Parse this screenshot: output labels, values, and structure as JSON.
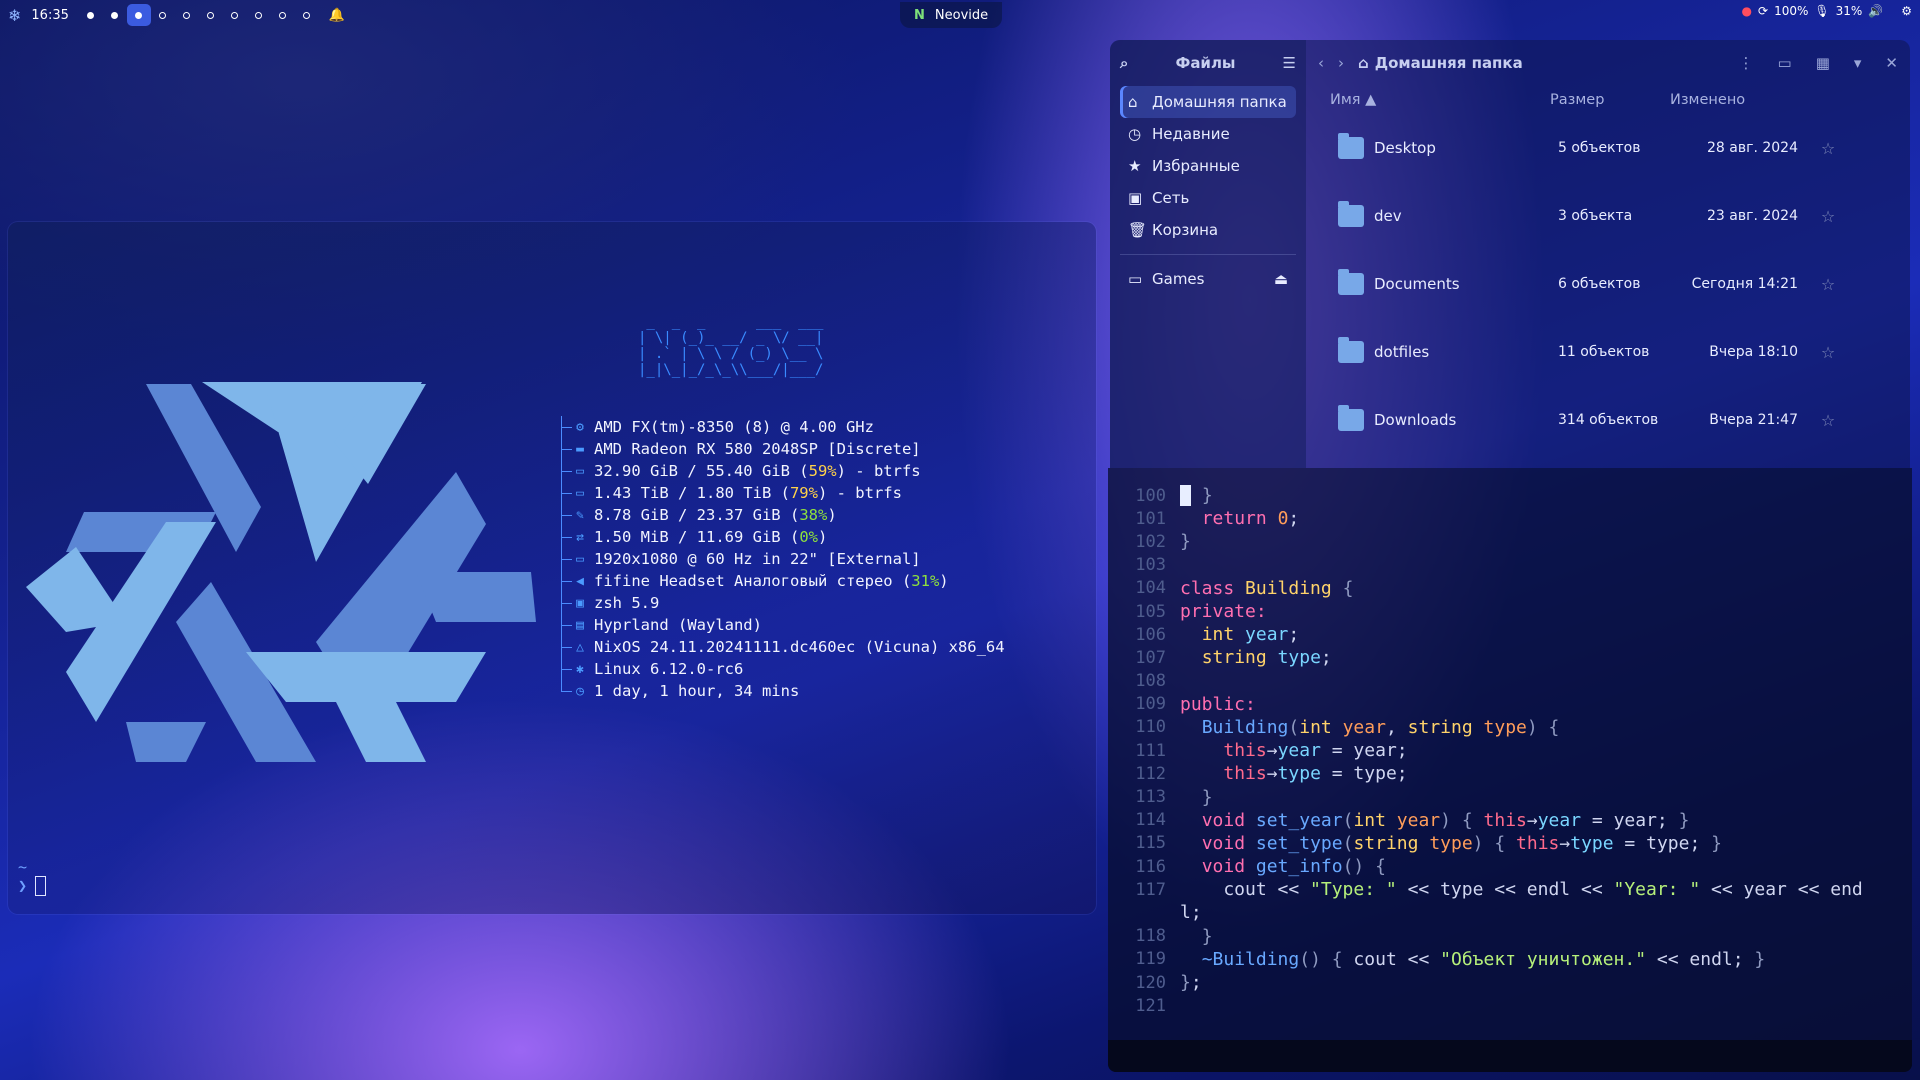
{
  "topbar": {
    "time": "16:35",
    "workspaces": [
      "full",
      "full",
      "active",
      "empty",
      "empty",
      "empty",
      "empty",
      "empty",
      "empty",
      "empty"
    ],
    "active_app": "Neovide",
    "battery": "100%",
    "volume": "31%",
    "icons": [
      "nixos-logo-icon",
      "bell-icon",
      "record-icon",
      "refresh-icon",
      "mic-icon",
      "speaker-icon",
      "gear-icon"
    ]
  },
  "terminal": {
    "ascii": " _  _  _      ___  ___\n| \\| (_)_ __/ _ \\/ __|\n| .` | \\ \\ / (_) \\__ \\\n|_|\\_|_/_\\_\\\\___/|___/",
    "info": [
      {
        "icon": "cpu-icon",
        "text": "AMD FX(tm)-8350 (8) @ 4.00 GHz",
        "pct": "",
        "suffix": ""
      },
      {
        "icon": "gpu-icon",
        "text": "AMD Radeon RX 580 2048SP [Discrete]",
        "pct": "",
        "suffix": ""
      },
      {
        "icon": "disk-icon",
        "text": "32.90 GiB / 55.40 GiB (",
        "pct": "59%",
        "pct_color": "y",
        "suffix": ") - btrfs"
      },
      {
        "icon": "disk-icon",
        "text": "1.43 TiB / 1.80 TiB (",
        "pct": "79%",
        "pct_color": "y",
        "suffix": ") - btrfs"
      },
      {
        "icon": "memory-icon",
        "text": "8.78 GiB / 23.37 GiB (",
        "pct": "38%",
        "pct_color": "g",
        "suffix": ")"
      },
      {
        "icon": "swap-icon",
        "text": "1.50 MiB / 11.69 GiB (",
        "pct": "0%",
        "pct_color": "g",
        "suffix": ")"
      },
      {
        "icon": "monitor-icon",
        "text": "1920x1080 @ 60 Hz in 22\" [External]",
        "pct": "",
        "suffix": ""
      },
      {
        "icon": "speaker-icon",
        "text": "fifine Headset Аналоговый стерео (",
        "pct": "31%",
        "pct_color": "g",
        "suffix": ")"
      },
      {
        "icon": "shell-icon",
        "text": "zsh 5.9",
        "pct": "",
        "suffix": ""
      },
      {
        "icon": "window-icon",
        "text": "Hyprland (Wayland)",
        "pct": "",
        "suffix": ""
      },
      {
        "icon": "nixos-icon",
        "text": "NixOS 24.11.20241111.dc460ec (Vicuna) x86_64",
        "pct": "",
        "suffix": ""
      },
      {
        "icon": "gear-icon",
        "text": "Linux 6.12.0-rc6",
        "pct": "",
        "suffix": ""
      },
      {
        "icon": "clock-icon",
        "text": "1 day, 1 hour, 34 mins",
        "pct": "",
        "suffix": ""
      }
    ],
    "prompt_dir": "~",
    "prompt_symbol": "❯"
  },
  "files": {
    "sidebar_title": "Файлы",
    "places": [
      {
        "label": "Домашняя папка",
        "icon": "home-icon",
        "selected": true
      },
      {
        "label": "Недавние",
        "icon": "clock-icon"
      },
      {
        "label": "Избранные",
        "icon": "star-icon"
      },
      {
        "label": "Сеть",
        "icon": "network-icon"
      },
      {
        "label": "Корзина",
        "icon": "trash-icon"
      }
    ],
    "devices": [
      {
        "label": "Games",
        "icon": "drive-icon"
      }
    ],
    "path": "Домашняя папка",
    "columns": {
      "name": "Имя",
      "size": "Размер",
      "modified": "Изменено"
    },
    "rows": [
      {
        "name": "Desktop",
        "size": "5 объектов",
        "date": "28 авг. 2024"
      },
      {
        "name": "dev",
        "size": "3 объекта",
        "date": "23 авг. 2024"
      },
      {
        "name": "Documents",
        "size": "6 объектов",
        "date": "Сегодня 14:21"
      },
      {
        "name": "dotfiles",
        "size": "11 объектов",
        "date": "Вчера 18:10"
      },
      {
        "name": "Downloads",
        "size": "314 объектов",
        "date": "Вчера 21:47"
      }
    ]
  },
  "editor": {
    "lines": [
      {
        "n": "100",
        "html": "<span class='ecursor'></span> <span class='pu'>}</span>"
      },
      {
        "n": "101",
        "html": "  <span class='kw'>return</span> <span class='nm'>0</span>;"
      },
      {
        "n": "102",
        "html": "<span class='pu'>}</span>"
      },
      {
        "n": "103",
        "html": ""
      },
      {
        "n": "104",
        "html": "<span class='kw'>class</span> <span class='ty'>Building</span> <span class='pu'>{</span>"
      },
      {
        "n": "105",
        "html": "<span class='kw'>private:</span>"
      },
      {
        "n": "106",
        "html": "  <span class='ty'>int</span> <span class='id'>year</span>;"
      },
      {
        "n": "107",
        "html": "  <span class='ty'>string</span> <span class='id'>type</span>;"
      },
      {
        "n": "108",
        "html": ""
      },
      {
        "n": "109",
        "html": "<span class='kw'>public:</span>"
      },
      {
        "n": "110",
        "html": "  <span class='fn'>Building</span><span class='pu'>(</span><span class='ty'>int</span> <span class='nm'>year</span>, <span class='ty'>string</span> <span class='nm'>type</span><span class='pu'>) {</span>"
      },
      {
        "n": "111",
        "html": "    <span class='th'>this</span>→<span class='id'>year</span> = year;"
      },
      {
        "n": "112",
        "html": "    <span class='th'>this</span>→<span class='id'>type</span> = type;"
      },
      {
        "n": "113",
        "html": "  <span class='pu'>}</span>"
      },
      {
        "n": "114",
        "html": "  <span class='kw'>void</span> <span class='fn'>set_year</span><span class='pu'>(</span><span class='ty'>int</span> <span class='nm'>year</span><span class='pu'>) {</span> <span class='th'>this</span>→<span class='id'>year</span> = year; <span class='pu'>}</span>"
      },
      {
        "n": "115",
        "html": "  <span class='kw'>void</span> <span class='fn'>set_type</span><span class='pu'>(</span><span class='ty'>string</span> <span class='nm'>type</span><span class='pu'>) {</span> <span class='th'>this</span>→<span class='id'>type</span> = type; <span class='pu'>}</span>"
      },
      {
        "n": "116",
        "html": "  <span class='kw'>void</span> <span class='fn'>get_info</span><span class='pu'>() {</span>"
      },
      {
        "n": "117",
        "html": "    cout &lt;&lt; <span class='st'>\"Type: \"</span> &lt;&lt; type &lt;&lt; endl &lt;&lt; <span class='st'>\"Year: \"</span> &lt;&lt; year &lt;&lt; end"
      },
      {
        "n": "",
        "html": "l;"
      },
      {
        "n": "118",
        "html": "  <span class='pu'>}</span>"
      },
      {
        "n": "119",
        "html": "  <span class='fn'>~Building</span><span class='pu'>() {</span> cout &lt;&lt; <span class='st'>\"Объект уничтожен.\"</span> &lt;&lt; endl; <span class='pu'>}</span>"
      },
      {
        "n": "120",
        "html": "<span class='pu'>}</span>;"
      },
      {
        "n": "121",
        "html": ""
      }
    ]
  }
}
